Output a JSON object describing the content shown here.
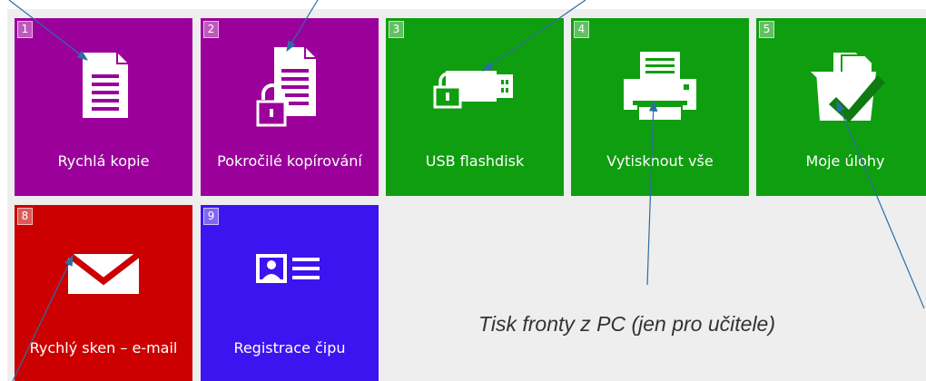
{
  "tiles": [
    {
      "number": "1",
      "label": "Rychlá kopie",
      "icon": "document-icon",
      "color": "#9b009b"
    },
    {
      "number": "2",
      "label": "Pokročilé kopírování",
      "icon": "document-lock-icon",
      "color": "#9b009b"
    },
    {
      "number": "3",
      "label": "USB flashdisk",
      "icon": "usb-lock-icon",
      "color": "#0f9e0f"
    },
    {
      "number": "4",
      "label": "Vytisknout vše",
      "icon": "printer-icon",
      "color": "#0f9e0f"
    },
    {
      "number": "5",
      "label": "Moje úlohy",
      "icon": "folder-check-icon",
      "color": "#0f9e0f"
    },
    {
      "number": "8",
      "label": "Rychlý sken – e-mail",
      "icon": "envelope-icon",
      "color": "#cc0000"
    },
    {
      "number": "9",
      "label": "Registrace čipu",
      "icon": "id-card-icon",
      "color": "#3c14f0"
    }
  ],
  "caption": "Tisk fronty z PC (jen pro učitele)"
}
